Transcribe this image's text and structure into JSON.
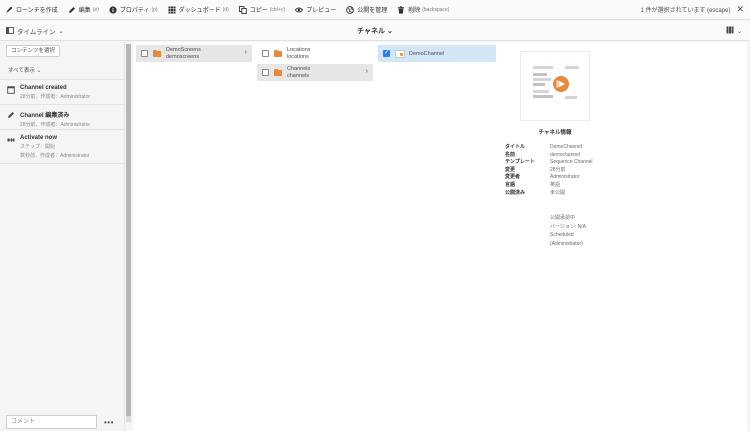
{
  "actionbar": {
    "create_launch": "ローンチを作成",
    "edit": "編集",
    "edit_sc": "(e)",
    "properties": "プロパティ",
    "properties_sc": "(p)",
    "dashboard": "ダッシュボード",
    "dashboard_sc": "(d)",
    "copy": "コピー",
    "copy_sc": "(ctrl+c)",
    "preview": "プレビュー",
    "manage_publication": "公開を管理",
    "delete": "削除",
    "delete_sc": "(backspace)",
    "selection_status": "1 件が選択されています (escape)"
  },
  "toolbar": {
    "rail_label": "タイムライン",
    "view_title": "チャネル"
  },
  "rail": {
    "filter_button": "コンテンツを選択",
    "show_all": "すべて表示",
    "items": [
      {
        "title": "Channel created",
        "sub1": "28分前、作成者：Administrator",
        "sub2": ""
      },
      {
        "title": "Channel 編集済み",
        "sub1": "28分前、作成者：Administrator",
        "sub2": ""
      },
      {
        "title": "Activate now",
        "sub1": "ステップ：開始",
        "sub2": "数秒前、作成者：Administrator"
      }
    ],
    "comment_placeholder": "コメント",
    "more": "•••"
  },
  "columns": {
    "col1": [
      {
        "title": "DemoScreens",
        "subtitle": "demoscreens"
      }
    ],
    "col2": [
      {
        "title": "Locations",
        "subtitle": "locations"
      },
      {
        "title": "Channels",
        "subtitle": "channels"
      }
    ],
    "col3": [
      {
        "title": "DemoChannel"
      }
    ]
  },
  "preview": {
    "heading": "チャネル情報",
    "meta": [
      {
        "key": "タイトル",
        "value": "DemoChannel"
      },
      {
        "key": "名前",
        "value": "demochannel"
      },
      {
        "key": "テンプレート",
        "value": "Sequence Channel"
      },
      {
        "key": "変更",
        "value": "28分前"
      },
      {
        "key": "変更者",
        "value": "Administrator"
      },
      {
        "key": "言語",
        "value": "英語"
      },
      {
        "key": "公開済み",
        "value": "未公開"
      }
    ],
    "extra": [
      "公開承認中",
      "バージョン: N/A",
      "Scheduled",
      "(Administrator)"
    ]
  },
  "colors": {
    "accent": "#2680eb",
    "folder": "#e8883a",
    "selected_row": "#d3e6f8"
  }
}
